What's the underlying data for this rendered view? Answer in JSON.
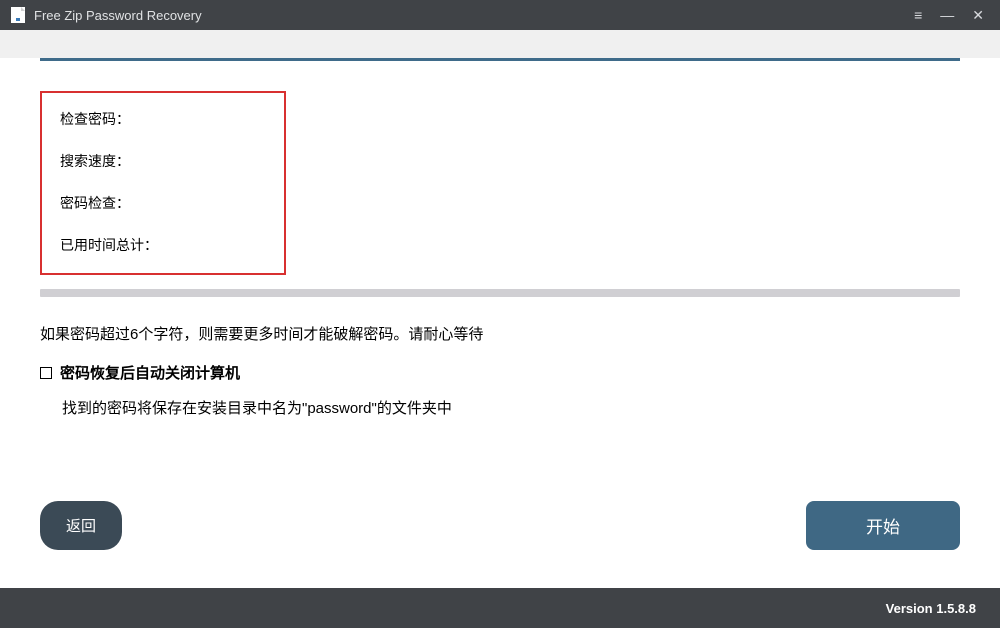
{
  "titlebar": {
    "title": "Free Zip Password Recovery"
  },
  "status": {
    "check_password": "检查密码：",
    "search_speed": "搜索速度：",
    "password_check": "密码检查：",
    "elapsed_time": "已用时间总计："
  },
  "info": {
    "long_password_hint": "如果密码超过6个字符，则需要更多时间才能破解密码。请耐心等待",
    "shutdown_checkbox": "密码恢复后自动关闭计算机",
    "save_location_note": "找到的密码将保存在安装目录中名为\"password\"的文件夹中"
  },
  "buttons": {
    "back": "返回",
    "start": "开始"
  },
  "footer": {
    "version": "Version 1.5.8.8"
  }
}
